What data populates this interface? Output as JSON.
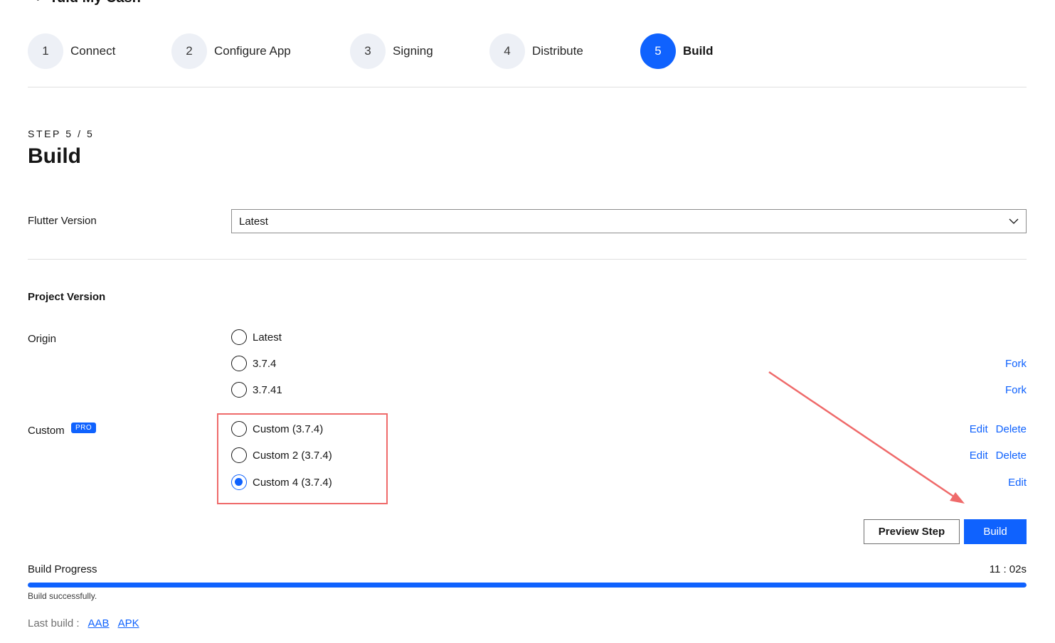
{
  "header": {
    "back_glyph": "‹",
    "app_title": "Tuid My Cash"
  },
  "steps": [
    {
      "number": "1",
      "label": "Connect",
      "active": false
    },
    {
      "number": "2",
      "label": "Configure App",
      "active": false
    },
    {
      "number": "3",
      "label": "Signing",
      "active": false
    },
    {
      "number": "4",
      "label": "Distribute",
      "active": false
    },
    {
      "number": "5",
      "label": "Build",
      "active": true
    }
  ],
  "page": {
    "step_counter": "STEP 5 / 5",
    "title": "Build"
  },
  "flutter_version": {
    "label": "Flutter Version",
    "selected": "Latest"
  },
  "project_version": {
    "title": "Project Version",
    "origin_label": "Origin",
    "origin_options": [
      {
        "label": "Latest",
        "checked": false,
        "action": ""
      },
      {
        "label": "3.7.4",
        "checked": false,
        "action": "Fork"
      },
      {
        "label": "3.7.41",
        "checked": false,
        "action": "Fork"
      }
    ],
    "custom_label": "Custom",
    "pro_badge": "PRO",
    "custom_options": [
      {
        "label": "Custom (3.7.4)",
        "checked": false,
        "edit": "Edit",
        "delete": "Delete"
      },
      {
        "label": "Custom 2 (3.7.4)",
        "checked": false,
        "edit": "Edit",
        "delete": "Delete"
      },
      {
        "label": "Custom 4 (3.7.4)",
        "checked": true,
        "edit": "Edit",
        "delete": ""
      }
    ]
  },
  "buttons": {
    "preview": "Preview Step",
    "build": "Build"
  },
  "progress": {
    "label": "Build Progress",
    "time": "11 : 02s",
    "percent": 100,
    "status": "Build successfully."
  },
  "last_build": {
    "label": "Last build :",
    "aab": "AAB",
    "apk": "APK"
  },
  "colors": {
    "accent": "#0f62fe",
    "annotation": "#ef6a6a"
  }
}
